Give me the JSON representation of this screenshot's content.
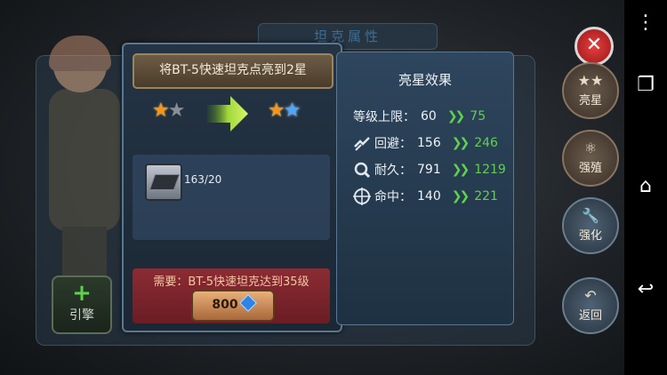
{
  "background": {
    "panel_title": "坦克属性",
    "engine_button_label": "引擎"
  },
  "upgrade_dialog": {
    "banner_text": "将BT-5快速坦克点亮到2星",
    "from_stars": {
      "filled": 1,
      "total": 2
    },
    "to_stars": {
      "filled": 2,
      "total": 2
    },
    "item": {
      "icon": "chip-icon",
      "count_text": "163/20"
    },
    "requirement_text": "需要：BT-5快速坦克达到35级",
    "cost_button": {
      "amount": "800",
      "currency_icon": "gem-icon"
    }
  },
  "effect_panel": {
    "title": "亮星效果",
    "stats": [
      {
        "icon": "",
        "name": "等级上限：",
        "current": "60",
        "new": "75"
      },
      {
        "icon": "dodge-icon",
        "name": "回避：",
        "current": "156",
        "new": "246"
      },
      {
        "icon": "durability-icon",
        "name": "耐久：",
        "current": "791",
        "new": "1219"
      },
      {
        "icon": "crosshair-icon",
        "name": "命中：",
        "current": "140",
        "new": "221"
      }
    ]
  },
  "side_menu": [
    {
      "icon": "stars-icon",
      "label": "亮星"
    },
    {
      "icon": "atom-icon",
      "label": "强殖"
    },
    {
      "icon": "wrench-icon",
      "label": "强化"
    },
    {
      "icon": "back-arrow-icon",
      "label": "返回"
    }
  ],
  "close_button": {
    "symbol": "✕"
  },
  "system_nav": {
    "menu_icon": "⋮",
    "recents_icon": "❐",
    "home_icon": "⌂",
    "back_icon": "↩"
  },
  "colors": {
    "banner": "#6d5c45",
    "requirement_bg": "#8c2b33",
    "star_filled": "#f7941d",
    "star_new": "#4ea6ff",
    "stat_increase": "#5fd24c",
    "close_red": "#e64040"
  }
}
